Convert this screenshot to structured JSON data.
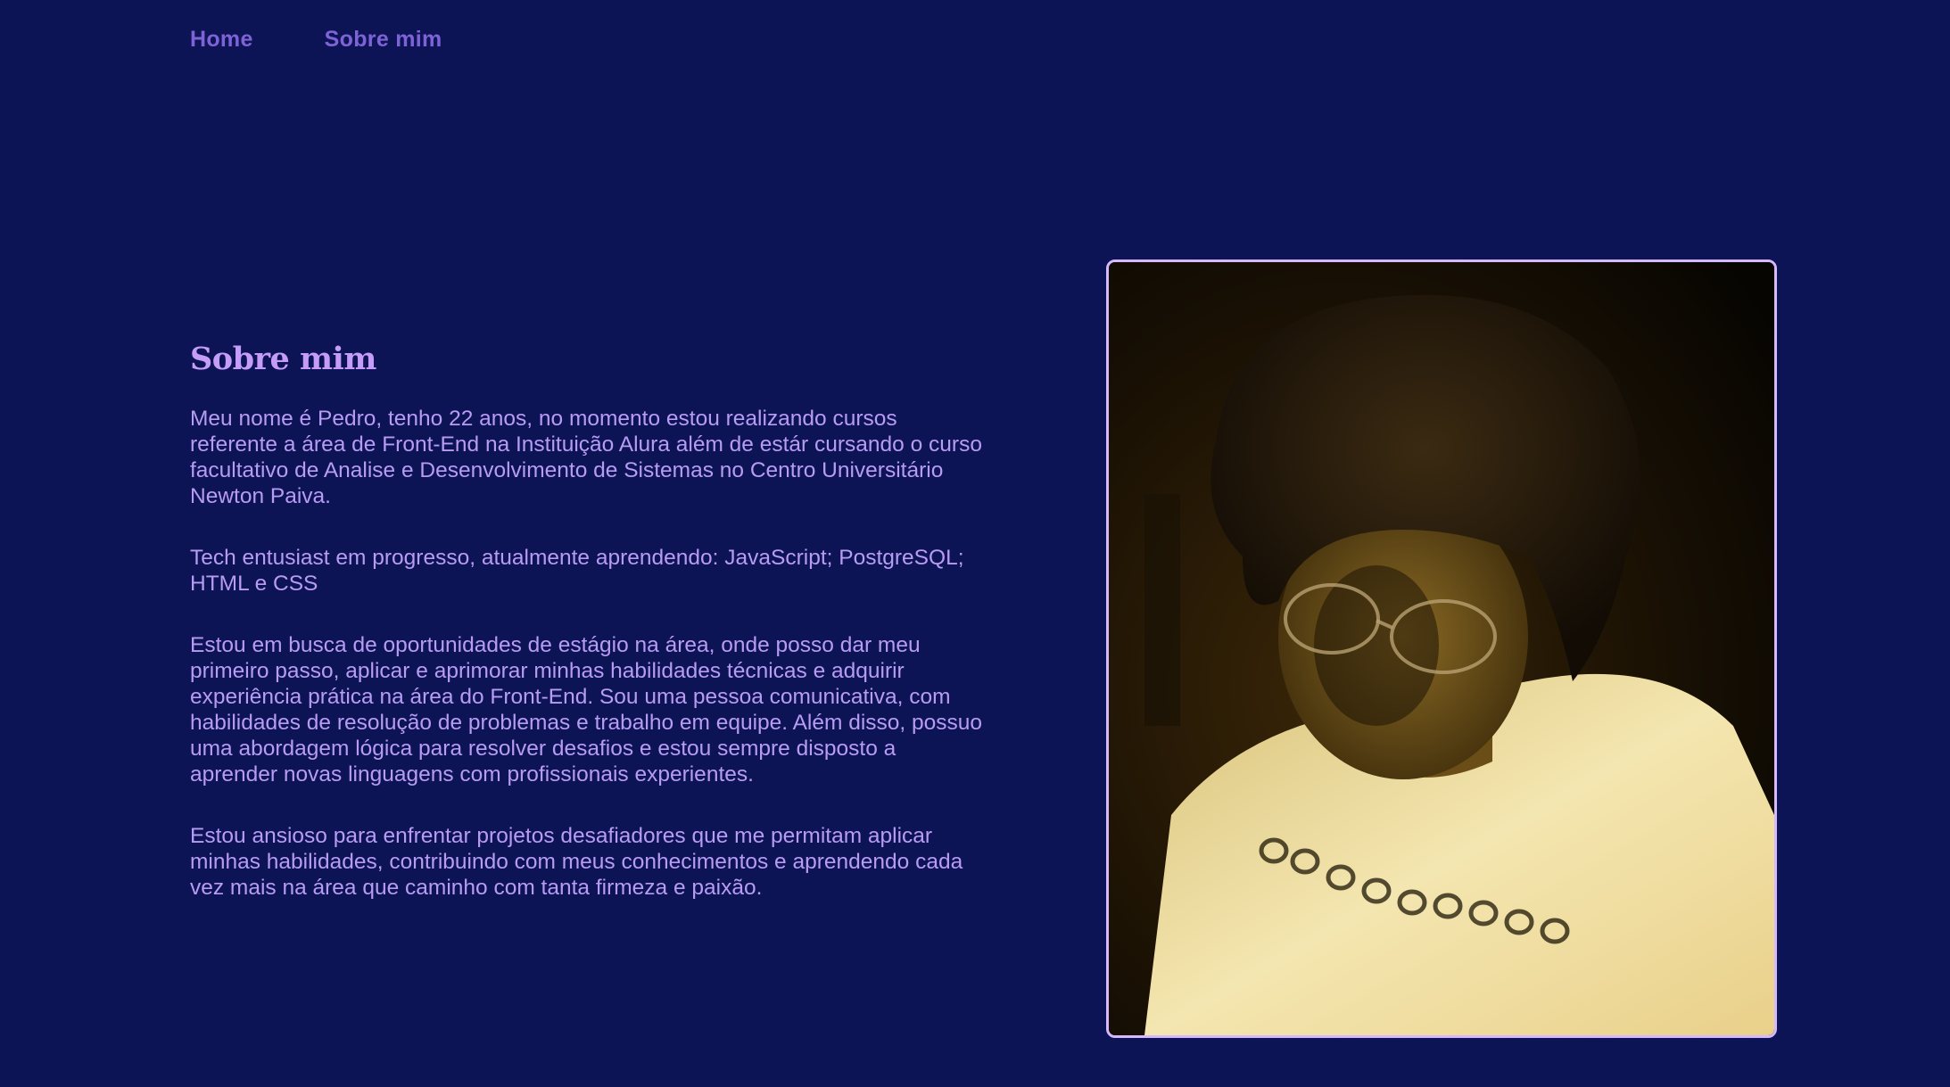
{
  "nav": {
    "items": [
      {
        "label": "Home"
      },
      {
        "label": "Sobre mim"
      }
    ]
  },
  "about": {
    "heading": "Sobre mim",
    "paragraphs": [
      "Meu nome é Pedro, tenho 22 anos, no momento estou realizando cursos referente a área de Front-End na Instituição Alura além de estár cursando o curso facultativo de Analise e Desenvolvimento de Sistemas no Centro Universitário Newton Paiva.",
      "Tech entusiast em progresso, atualmente aprendendo: JavaScript; PostgreSQL; HTML e CSS",
      "Estou em busca de oportunidades de estágio na área, onde posso dar meu primeiro passo, aplicar e aprimorar minhas habilidades técnicas e adquirir experiência prática na área do Front-End. Sou uma pessoa comunicativa, com habilidades de resolução de problemas e trabalho em equipe. Além disso, possuo uma abordagem lógica para resolver desafios e estou sempre disposto a aprender novas linguagens com profissionais experientes.",
      "Estou ansioso para enfrentar projetos desafiadores que me permitam aplicar minhas habilidades, contribuindo com meus conhecimentos e aprendendo cada vez mais na área que caminho com tanta firmeza e paixão."
    ]
  },
  "photo": {
    "subject": "portrait-photo",
    "border_color": "#d6b8ff"
  },
  "colors": {
    "background": "#0c1456",
    "nav_link": "#7e63d6",
    "heading": "#c59cf8",
    "text": "#b89bf2"
  }
}
